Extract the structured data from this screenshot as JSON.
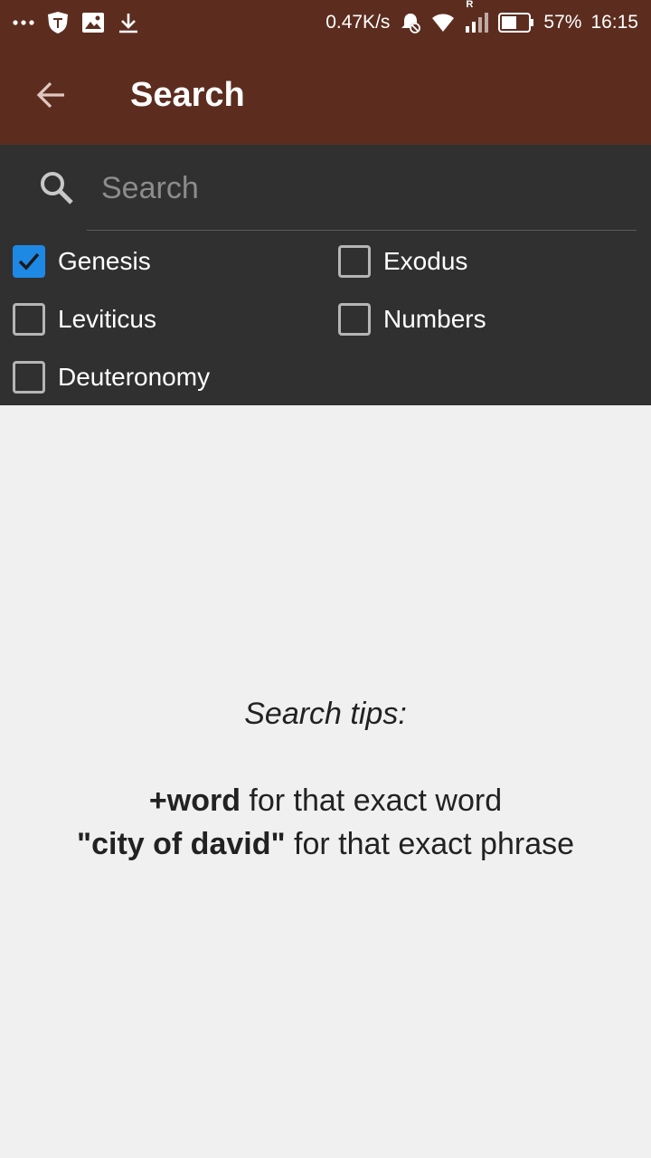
{
  "status_bar": {
    "speed": "0.47K/s",
    "roaming": "R",
    "battery": "57%",
    "time": "16:15"
  },
  "app_bar": {
    "title": "Search"
  },
  "search": {
    "placeholder": "Search",
    "value": ""
  },
  "books": [
    {
      "label": "Genesis",
      "checked": true
    },
    {
      "label": "Exodus",
      "checked": false
    },
    {
      "label": "Leviticus",
      "checked": false
    },
    {
      "label": "Numbers",
      "checked": false
    },
    {
      "label": "Deuteronomy",
      "checked": false
    }
  ],
  "tips": {
    "title": "Search tips:",
    "line1_bold": "+word",
    "line1_rest": " for that exact word",
    "line2_bold": "\"city of david\"",
    "line2_rest": " for that exact phrase"
  },
  "colors": {
    "app_bar": "#5c2d1f",
    "panel": "#303030",
    "checkbox_checked": "#1e88e5",
    "background": "#f0f0f0"
  }
}
